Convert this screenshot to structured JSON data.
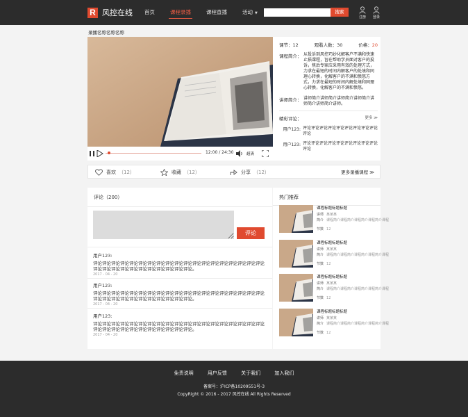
{
  "header": {
    "logo_mark": "R",
    "brand": "风控在线",
    "nav": [
      {
        "label": "首页",
        "active": false
      },
      {
        "label": "课程录播",
        "active": true
      },
      {
        "label": "课程直播",
        "active": false
      },
      {
        "label": "活动",
        "active": false
      }
    ],
    "search_placeholder": "",
    "search_button": "搜索",
    "register_label": "注册",
    "login_label": "登录"
  },
  "course": {
    "title": "录播名称名称名称",
    "lessons": "课节：12",
    "viewers": "观看人数：30",
    "price_label": "价格：",
    "price_value": "20",
    "intro_label": "课程简介：",
    "intro_text": "从投诉到风控巧妙化解客户不满和快速止损课程，旨在帮助学员面对客户的投诉，焦后专家应采用有效的处理方式，力求在最短的时间内解客户的处境和同理心转换，化解客户的不满和愤怒方式，力求在最短的时间内解处境和同理心转换，化解客户的不满和愤怒。",
    "teacher_label": "讲师简介：",
    "teacher_text": "讲师简介讲师简介讲师简介讲师简介讲师简介讲师简介讲师。",
    "reviews_label": "精彩评论：",
    "reviews_more": "更多",
    "reviews": [
      {
        "user": "用户123:",
        "text": "评论评论评论评论评论评论评论评论评论评论"
      },
      {
        "user": "用户123:",
        "text": "评论评论评论评论评论评论评论评论评论评论"
      }
    ]
  },
  "player": {
    "time": "12:00 / 24:30",
    "quality": "超清",
    "progress": 0.02
  },
  "actions": {
    "like_label": "喜欢",
    "like_count": "（12）",
    "fav_label": "收藏",
    "fav_count": "（12）",
    "share_label": "分享",
    "share_count": "（12）",
    "more_courses": "更多录播课程"
  },
  "comments": {
    "title": "评论（200）",
    "input_placeholder": "",
    "submit": "评论",
    "items": [
      {
        "user": "用户123:",
        "text": "评论评论评论评论评论评论评论评论评论评论评论评论评论评论评论评论评论评论评论评论评论评论评论评论评论评论评论评论评论评论。",
        "date": "2017 - 04 - 20"
      },
      {
        "user": "用户123:",
        "text": "评论评论评论评论评论评论评论评论评论评论评论评论评论评论评论评论评论评论评论评论评论评论评论评论评论评论评论评论评论评论。",
        "date": "2017 - 04 - 20"
      },
      {
        "user": "用户123:",
        "text": "评论评论评论评论评论评论评论评论评论评论评论评论评论评论评论评论评论评论评论评论评论评论评论评论评论评论评论评论评论评论。",
        "date": "2017 - 04 - 20"
      }
    ]
  },
  "hot": {
    "title": "热门推荐",
    "items": [
      {
        "name": "课程标题标题标题",
        "teacher_label": "讲师",
        "teacher": "某某某",
        "intro_label": "简介",
        "intro": "课程简介课程简介课程简介课程简介课程",
        "lessons_label": "节数",
        "lessons": "12"
      },
      {
        "name": "课程标题标题标题",
        "teacher_label": "讲师",
        "teacher": "某某某",
        "intro_label": "简介",
        "intro": "课程简介课程简介课程简介课程简介课程",
        "lessons_label": "节数",
        "lessons": "12"
      },
      {
        "name": "课程标题标题标题",
        "teacher_label": "讲师",
        "teacher": "某某某",
        "intro_label": "简介",
        "intro": "课程简介课程简介课程简介课程简介课程",
        "lessons_label": "节数",
        "lessons": "12"
      },
      {
        "name": "课程标题标题标题",
        "teacher_label": "讲师",
        "teacher": "某某某",
        "intro_label": "简介",
        "intro": "课程简介课程简介课程简介课程简介课程",
        "lessons_label": "节数",
        "lessons": "12"
      }
    ]
  },
  "footer": {
    "links": [
      "免责说明",
      "用户反馈",
      "关于我们",
      "加入我们"
    ],
    "icp": "备案号：沪ICP备10209551号-3",
    "copyright": "CopyRight © 2016 - 2017 风控在线 All Rights Reserved"
  },
  "colors": {
    "accent": "#e04a2f",
    "header_bg": "#2c2c2c"
  }
}
